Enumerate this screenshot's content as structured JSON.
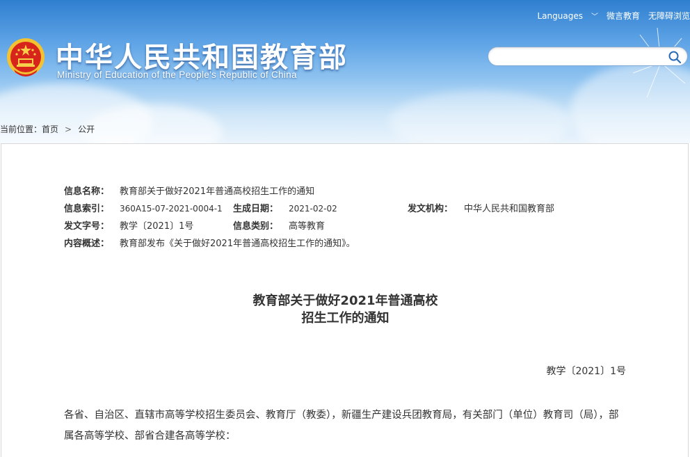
{
  "header": {
    "top_links": {
      "languages": "Languages",
      "wechat": "微言教育",
      "accessibility": "无障碍浏览"
    },
    "title_cn": "中华人民共和国教育部",
    "title_en": "Ministry of Education of the People's Republic of China",
    "search": {
      "placeholder": "",
      "value": ""
    }
  },
  "breadcrumb": {
    "prefix": "当前位置：",
    "home": "首页",
    "separator": ">",
    "current": "公开"
  },
  "meta": {
    "name_label": "信息名称：",
    "name_value": "教育部关于做好2021年普通高校招生工作的通知",
    "index_label": "信息索引：",
    "index_value": "360A15-07-2021-0004-1",
    "date_label": "生成日期：",
    "date_value": "2021-02-02",
    "agency_label": "发文机构：",
    "agency_value": "中华人民共和国教育部",
    "docno_label": "发文字号：",
    "docno_value": "教学〔2021〕1号",
    "category_label": "信息类别：",
    "category_value": "高等教育",
    "summary_label": "内容概述：",
    "summary_value": "教育部发布《关于做好2021年普通高校招生工作的通知》。"
  },
  "article": {
    "title_line1": "教育部关于做好2021年普通高校",
    "title_line2": "招生工作的通知",
    "doc_number": "教学〔2021〕1号",
    "body": "各省、自治区、直辖市高等学校招生委员会、教育厅（教委），新疆生产建设兵团教育局，有关部门（单位）教育司（局），部属各高等学校、部省合建各高等学校："
  },
  "colors": {
    "header_blue": "#2f7fd0",
    "text": "#333333"
  }
}
